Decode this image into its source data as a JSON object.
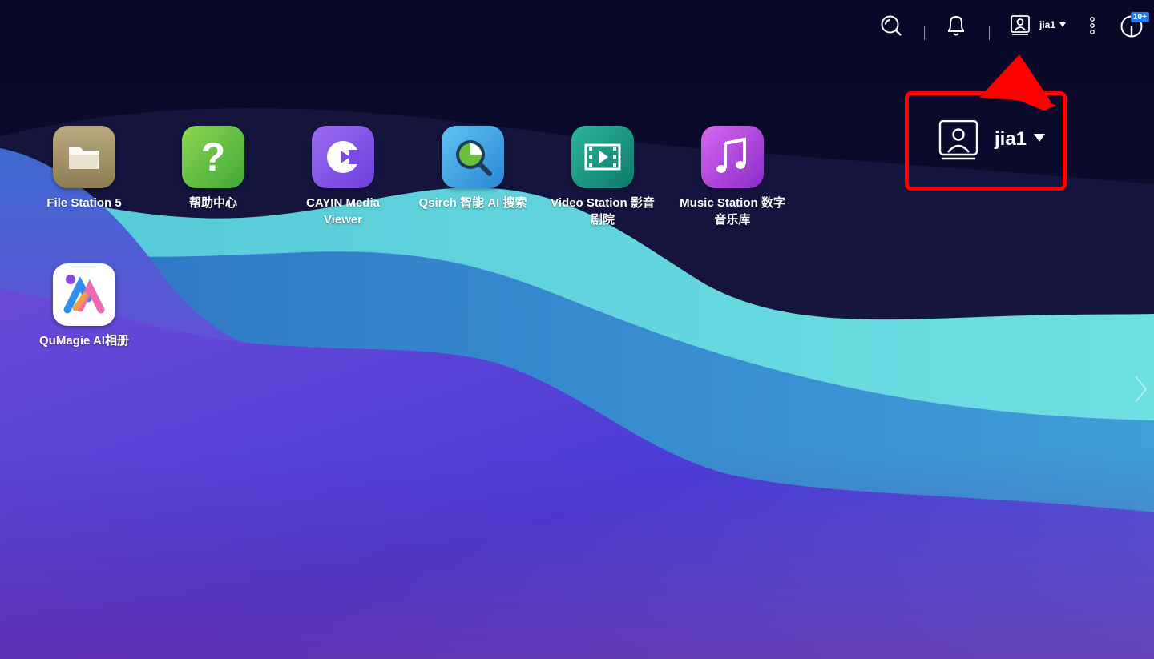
{
  "topbar": {
    "username": "jia1",
    "notification_badge": "10+",
    "icons": [
      "search-icon",
      "bell-icon",
      "user-icon",
      "more-vertical-icon",
      "dashboard-icon"
    ]
  },
  "apps": [
    {
      "label": "File Station 5",
      "icon": "folder-icon"
    },
    {
      "label": "帮助中心",
      "icon": "help-icon"
    },
    {
      "label": "CAYIN Media Viewer",
      "icon": "cayin-icon"
    },
    {
      "label": "Qsirch 智能 AI 搜索",
      "icon": "qsirch-icon"
    },
    {
      "label": "Video Station 影音剧院",
      "icon": "video-icon"
    },
    {
      "label": "Music Station 数字音乐库",
      "icon": "music-icon"
    },
    {
      "label": "QuMagie AI相册",
      "icon": "qumagie-icon"
    }
  ],
  "callout": {
    "username": "jia1",
    "color": "#ff0000"
  },
  "colors": {
    "background_dark": "#0b0a2a",
    "wave_cyan": "#64d8de",
    "wave_blue": "#3d8fd0",
    "wave_purple": "#5b3fd0",
    "accent_red": "#ff0000",
    "badge_blue": "#1e7cf2"
  }
}
